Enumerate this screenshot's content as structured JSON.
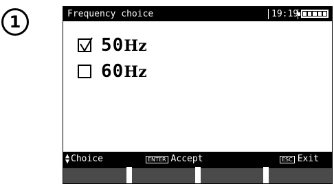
{
  "step": {
    "number": "1"
  },
  "titlebar": {
    "title": "Frequency choice",
    "clock": "19:19",
    "battery_level": 1.0
  },
  "options": [
    {
      "value": "50",
      "unit": "Hz",
      "checked": true
    },
    {
      "value": "60",
      "unit": "Hz",
      "checked": false
    }
  ],
  "hints": {
    "choice": "Choice",
    "enter_key": "ENTER",
    "accept": "Accept",
    "esc_key": "ESC",
    "exit": "Exit"
  },
  "softkeys": [
    "",
    "",
    "",
    ""
  ],
  "colors": {
    "bar": "#000000",
    "softkey": "#4a4a4a"
  }
}
